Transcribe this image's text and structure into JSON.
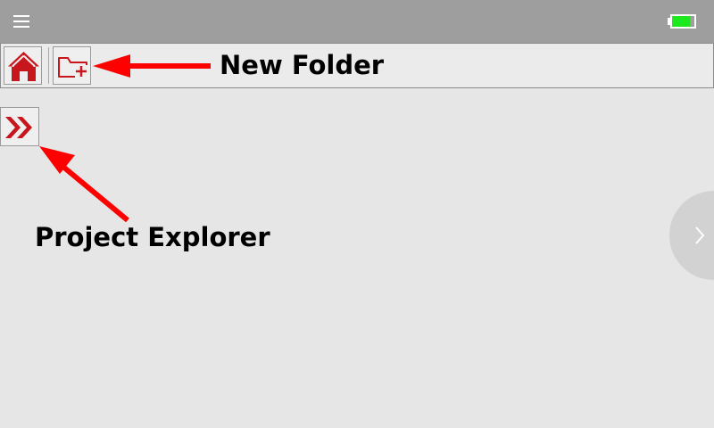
{
  "statusbar": {
    "menu_icon": "hamburger-menu-icon",
    "battery_icon": "battery-icon",
    "battery_level": 0.8,
    "battery_color": "#1ee81e"
  },
  "toolbar": {
    "home_icon": "home-icon",
    "new_folder_icon": "folder-plus-icon"
  },
  "side": {
    "explorer_icon": "double-chevron-right-icon",
    "next_icon": "chevron-right-icon"
  },
  "callouts": {
    "new_folder": "New Folder",
    "project_explorer": "Project Explorer",
    "arrow_color": "#ff0000"
  },
  "colors": {
    "accent": "#c8161d",
    "topbar": "#9e9e9e",
    "background": "#e6e6e6"
  }
}
